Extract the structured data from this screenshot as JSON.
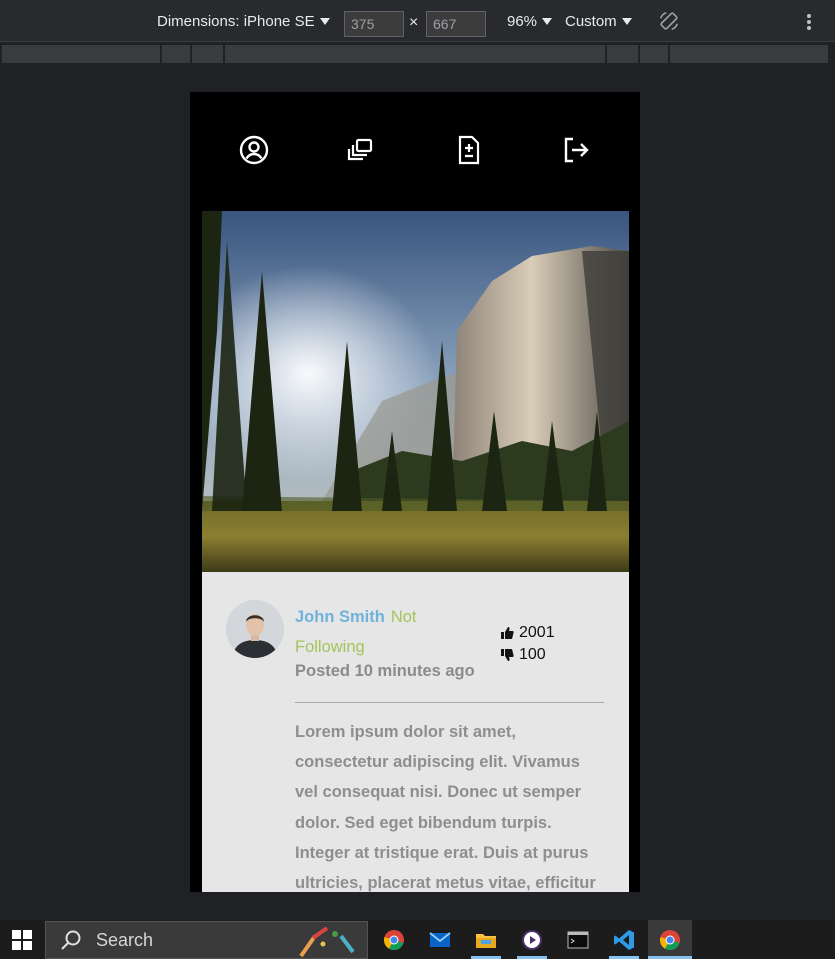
{
  "devtools": {
    "device_label": "Dimensions: iPhone SE",
    "width_value": "375",
    "height_value": "667",
    "times": "×",
    "zoom": "96%",
    "throttle": "Custom"
  },
  "app": {
    "nav": [
      {
        "icon": "profile-icon"
      },
      {
        "icon": "gallery-icon"
      },
      {
        "icon": "new-post-icon"
      },
      {
        "icon": "logout-icon"
      }
    ],
    "post": {
      "author": "John Smith",
      "follow_status": "Not Following",
      "posted": "Posted 10 minutes ago",
      "likes": "2001",
      "dislikes": "100",
      "body": "Lorem ipsum dolor sit amet, consectetur adipiscing elit. Vivamus vel consequat nisi. Donec ut semper dolor. Sed eget bibendum turpis. Integer at tristique erat. Duis at purus ultricies, placerat metus vitae, efficitur"
    }
  },
  "taskbar": {
    "search_label": "Search",
    "apps": [
      "chrome-icon",
      "mail-icon",
      "file-explorer-icon",
      "media-player-icon",
      "terminal-icon",
      "vscode-icon",
      "chrome-icon"
    ]
  },
  "colors": {
    "author": "#6fb3dd",
    "follow": "#a4c45c",
    "card_bg": "#e6e6e6",
    "accent": "#86c1f0"
  }
}
